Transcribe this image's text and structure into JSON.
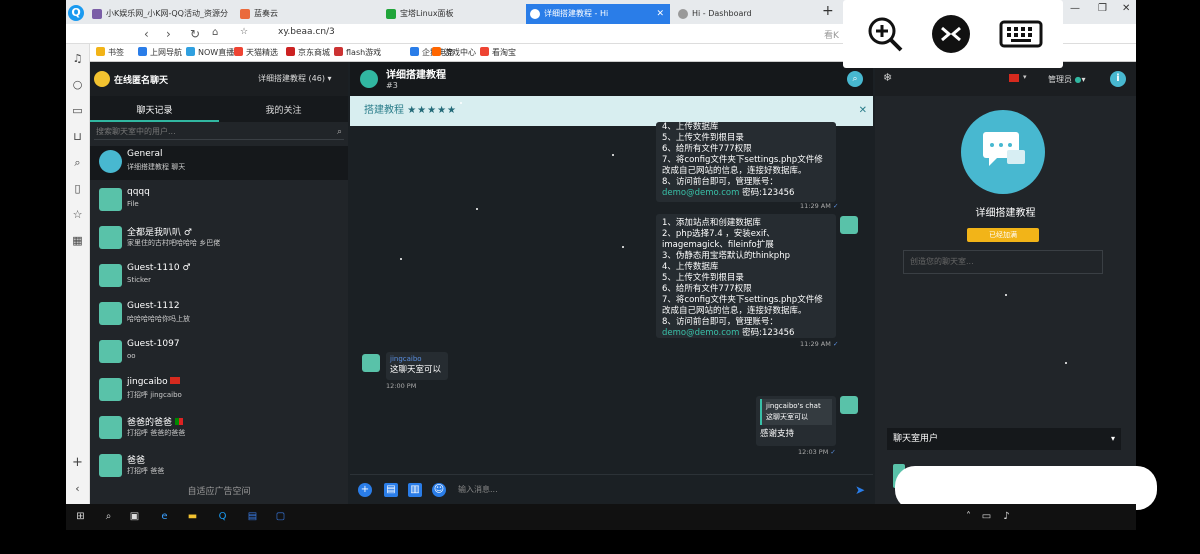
{
  "browser": {
    "tabs": [
      {
        "label": "小K娱乐网_小K网-QQ活动_资源分享",
        "color": "#7b5ea7"
      },
      {
        "label": "蓝奏云",
        "color": "#ea6a3c"
      },
      {
        "label": "宝塔Linux面板",
        "color": "#20a53a"
      },
      {
        "label": "详细搭建教程 - Hi",
        "color": "#ffffff"
      },
      {
        "label": "Hi - Dashboard",
        "color": "#666666"
      }
    ],
    "url": "xy.beaa.cn/3",
    "bookmarks": [
      "书签",
      "上网导航",
      "NOW直播",
      "天猫精选",
      "京东商城",
      "flash游戏",
      "企鹅电竞",
      "游戏中心",
      "看淘宝"
    ],
    "extra_label": "看K"
  },
  "left": {
    "brand": "在线匿名聊天",
    "room_selector": "详细搭建教程 (46)",
    "tabs": [
      "聊天记录",
      "我的关注"
    ],
    "search_placeholder": "搜索聊天室中的用户...",
    "chats": [
      {
        "name": "General",
        "preview": "详细搭建教程 聊天"
      },
      {
        "name": "qqqq",
        "preview": "File"
      },
      {
        "name": "全都是我叭叭 ♂",
        "preview": "家里住的古村吧哈哈哈 乡巴佬"
      },
      {
        "name": "Guest-1110 ♂",
        "preview": "Sticker"
      },
      {
        "name": "Guest-1112",
        "preview": "哈哈哈哈哈你吗上放"
      },
      {
        "name": "Guest-1097",
        "preview": "oo"
      },
      {
        "name": "jingcaibo",
        "preview": "打招呼 jingcaibo"
      },
      {
        "name": "爸爸的爸爸",
        "preview": "打招呼 爸爸的爸爸"
      },
      {
        "name": "爸爸",
        "preview": "打招呼 爸爸"
      }
    ],
    "ad_text": "自适应广告空间"
  },
  "mid": {
    "title": "详细搭建教程",
    "subtitle": "#3",
    "notice": "搭建教程",
    "notice_stars": "★★★★★",
    "msg1": {
      "lines": [
        "4、上传数据库",
        "5、上传文件到根目录",
        "6、给所有文件777权限",
        "7、将config文件夹下settings.php文件修",
        "改成自己网站的信息，连接好数据库。",
        "8、访问前台即可，管理账号："
      ],
      "email": "demo@demo.com",
      "password": " 密码:123456",
      "time": "11:29 AM"
    },
    "msg2": {
      "lines": [
        "1、添加站点和创建数据库",
        "2、php选择7.4 ，安装exif、",
        "imagemagick、fileinfo扩展",
        "3、伪静态用宝塔默认的thinkphp",
        "4、上传数据库",
        "5、上传文件到根目录",
        "6、给所有文件777权限",
        "7、将config文件夹下settings.php文件修",
        "改成自己网站的信息，连接好数据库。",
        "8、访问前台即可，管理账号："
      ],
      "email": "demo@demo.com",
      "password": " 密码:123456",
      "time": "11:29 AM"
    },
    "msg3": {
      "user": "jingcaibo",
      "text": "这聊天室可以",
      "time": "12:00 PM"
    },
    "msg4": {
      "quote_user": "jingcaibo's chat",
      "quote_text": "这聊天室可以",
      "text": "感谢支持",
      "time": "12:03 PM"
    },
    "composer_placeholder": "输入消息..."
  },
  "right": {
    "admin": "管理员",
    "room_name": "详细搭建教程",
    "badge": "已经加满",
    "input_placeholder": "创造您的聊天室...",
    "users_header": "聊天室用户"
  }
}
